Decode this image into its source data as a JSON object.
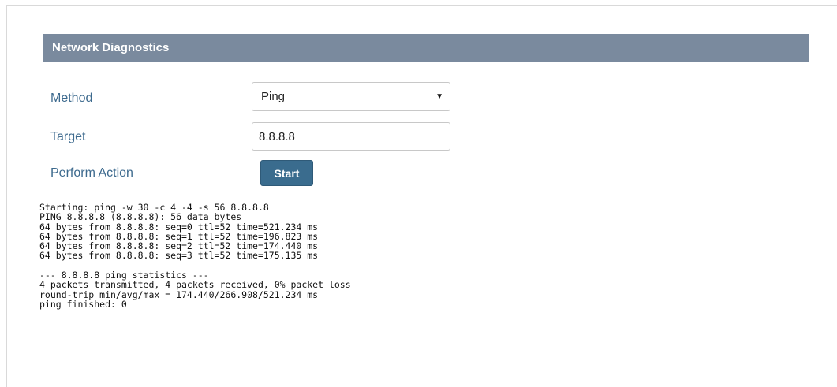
{
  "panel": {
    "title": "Network Diagnostics"
  },
  "form": {
    "method_label": "Method",
    "method_value": "Ping",
    "target_label": "Target",
    "target_value": "8.8.8.8",
    "action_label": "Perform Action",
    "start_label": "Start"
  },
  "output": {
    "lines": [
      "Starting: ping -w 30 -c 4 -4 -s 56 8.8.8.8",
      "PING 8.8.8.8 (8.8.8.8): 56 data bytes",
      "64 bytes from 8.8.8.8: seq=0 ttl=52 time=521.234 ms",
      "64 bytes from 8.8.8.8: seq=1 ttl=52 time=196.823 ms",
      "64 bytes from 8.8.8.8: seq=2 ttl=52 time=174.440 ms",
      "64 bytes from 8.8.8.8: seq=3 ttl=52 time=175.135 ms",
      "",
      "--- 8.8.8.8 ping statistics ---",
      "4 packets transmitted, 4 packets received, 0% packet loss",
      "round-trip min/avg/max = 174.440/266.908/521.234 ms",
      "ping finished: 0"
    ]
  },
  "colors": {
    "header_bg": "#7a8a9e",
    "label_text": "#3d6a8e",
    "button_bg": "#3a6c8e"
  },
  "icons": {
    "select_arrow": "caret-down-icon"
  }
}
